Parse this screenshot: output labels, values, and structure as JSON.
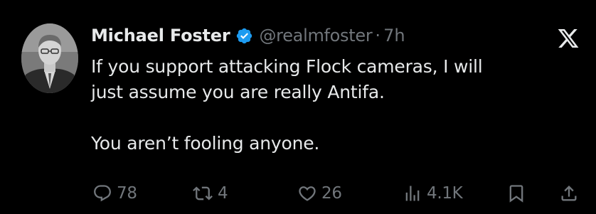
{
  "tweet": {
    "author": {
      "display_name": "Michael Foster",
      "handle": "@realmfoster",
      "separator": "·",
      "time": "7h",
      "verified": true,
      "verified_color": "#1d9bf0"
    },
    "text": {
      "line1": "If you support attacking Flock cameras, I will",
      "line2": "just assume you are really Antifa.",
      "line3": "You aren’t fooling anyone."
    },
    "actions": {
      "replies": "78",
      "reposts": "4",
      "likes": "26",
      "views": "4.1K"
    },
    "icons": {
      "reply": "reply-icon",
      "repost": "repost-icon",
      "like": "heart-icon",
      "views": "views-icon",
      "bookmark": "bookmark-icon",
      "share": "share-icon",
      "platform": "x-logo-icon"
    },
    "colors": {
      "background": "#000000",
      "text": "#e7e9ea",
      "muted": "#71767b"
    }
  }
}
